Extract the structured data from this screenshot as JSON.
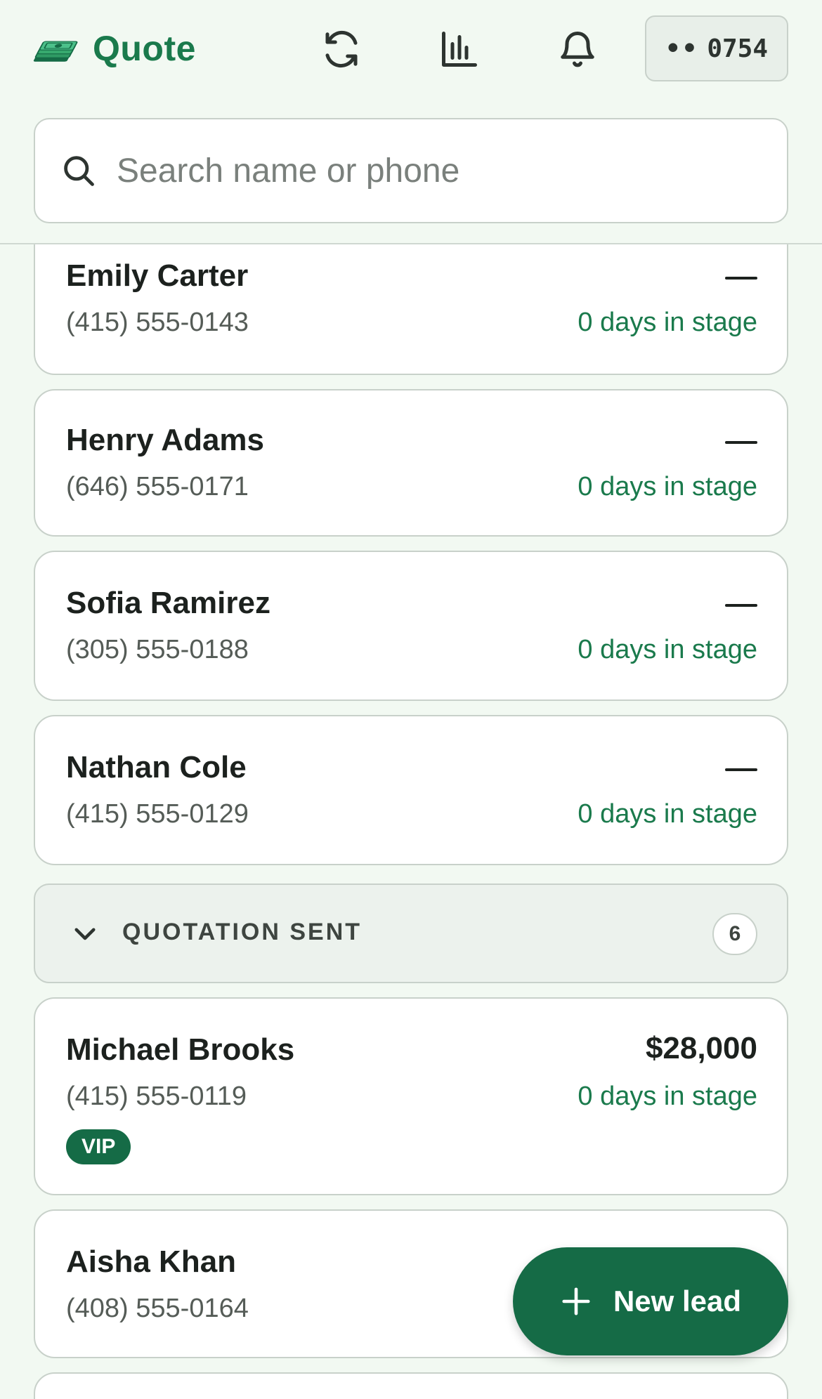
{
  "header": {
    "brand_name": "Quote",
    "account_chip": {
      "dots": "••",
      "label": "0754"
    }
  },
  "search": {
    "placeholder": "Search name or phone",
    "value": ""
  },
  "leads_top": [
    {
      "name": "Emily Carter",
      "phone": "(415) 555-0143",
      "value": "—",
      "stage": "0 days in stage"
    },
    {
      "name": "Henry Adams",
      "phone": "(646) 555-0171",
      "value": "—",
      "stage": "0 days in stage"
    },
    {
      "name": "Sofia Ramirez",
      "phone": "(305) 555-0188",
      "value": "—",
      "stage": "0 days in stage"
    },
    {
      "name": "Nathan Cole",
      "phone": "(415) 555-0129",
      "value": "—",
      "stage": "0 days in stage"
    }
  ],
  "group": {
    "title": "QUOTATION SENT",
    "count": "6"
  },
  "leads_quotation": [
    {
      "name": "Michael Brooks",
      "phone": "(415) 555-0119",
      "value": "$28,000",
      "stage": "0 days in stage",
      "tag": "VIP"
    },
    {
      "name": "Aisha Khan",
      "phone": "(408) 555-0164"
    }
  ],
  "fab": {
    "label": "New lead"
  },
  "colors": {
    "accent": "#1a7a4c",
    "fab": "#156b46",
    "background": "#f2f9f2"
  }
}
